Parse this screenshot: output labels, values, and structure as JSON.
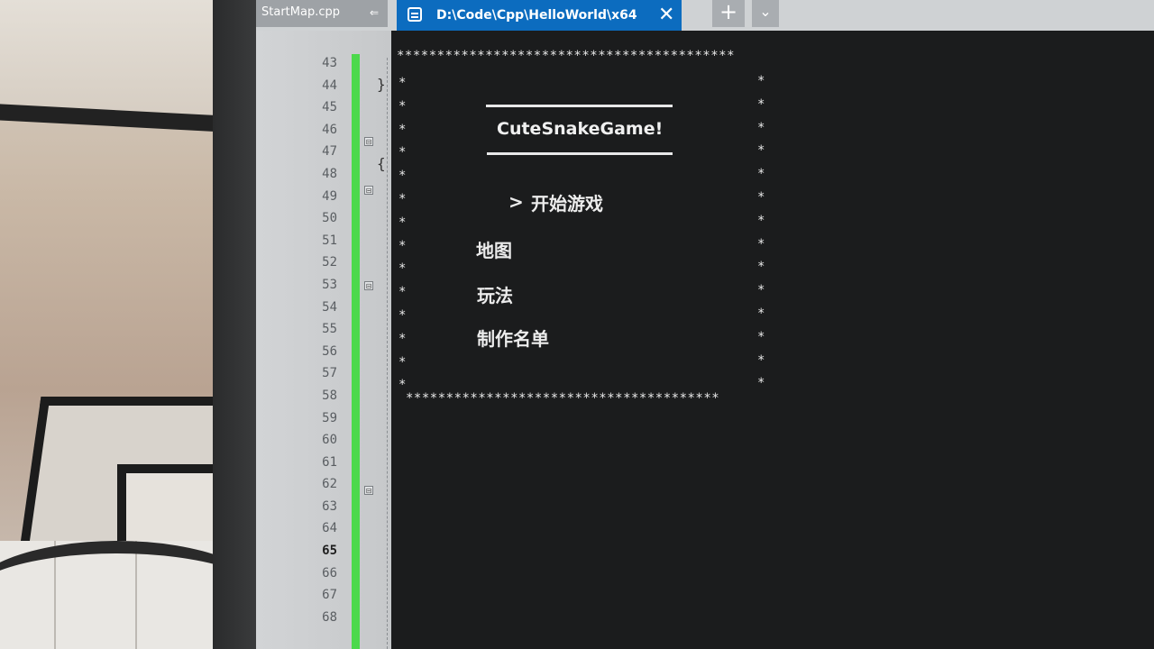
{
  "tabs": {
    "inactive_label": "StartMap.cpp",
    "active_label": "D:\\Code\\Cpp\\HelloWorld\\x64",
    "close_glyph": "✕",
    "add_glyph": "+",
    "more_glyph": "⌄"
  },
  "editor": {
    "line_numbers": [
      "43",
      "44",
      "45",
      "46",
      "47",
      "48",
      "49",
      "50",
      "51",
      "52",
      "53",
      "54",
      "55",
      "56",
      "57",
      "58",
      "59",
      "60",
      "61",
      "62",
      "63",
      "64",
      "65",
      "66",
      "67",
      "68"
    ],
    "current_line": "65",
    "change_bar_color": "#4cd94c"
  },
  "console": {
    "border_char": "*",
    "game_title": "CuteSnakeGame!",
    "cursor": ">",
    "menu": [
      {
        "label": "开始游戏",
        "selected": true
      },
      {
        "label": "地图",
        "selected": false
      },
      {
        "label": "玩法",
        "selected": false
      },
      {
        "label": "制作名单",
        "selected": false
      }
    ]
  }
}
